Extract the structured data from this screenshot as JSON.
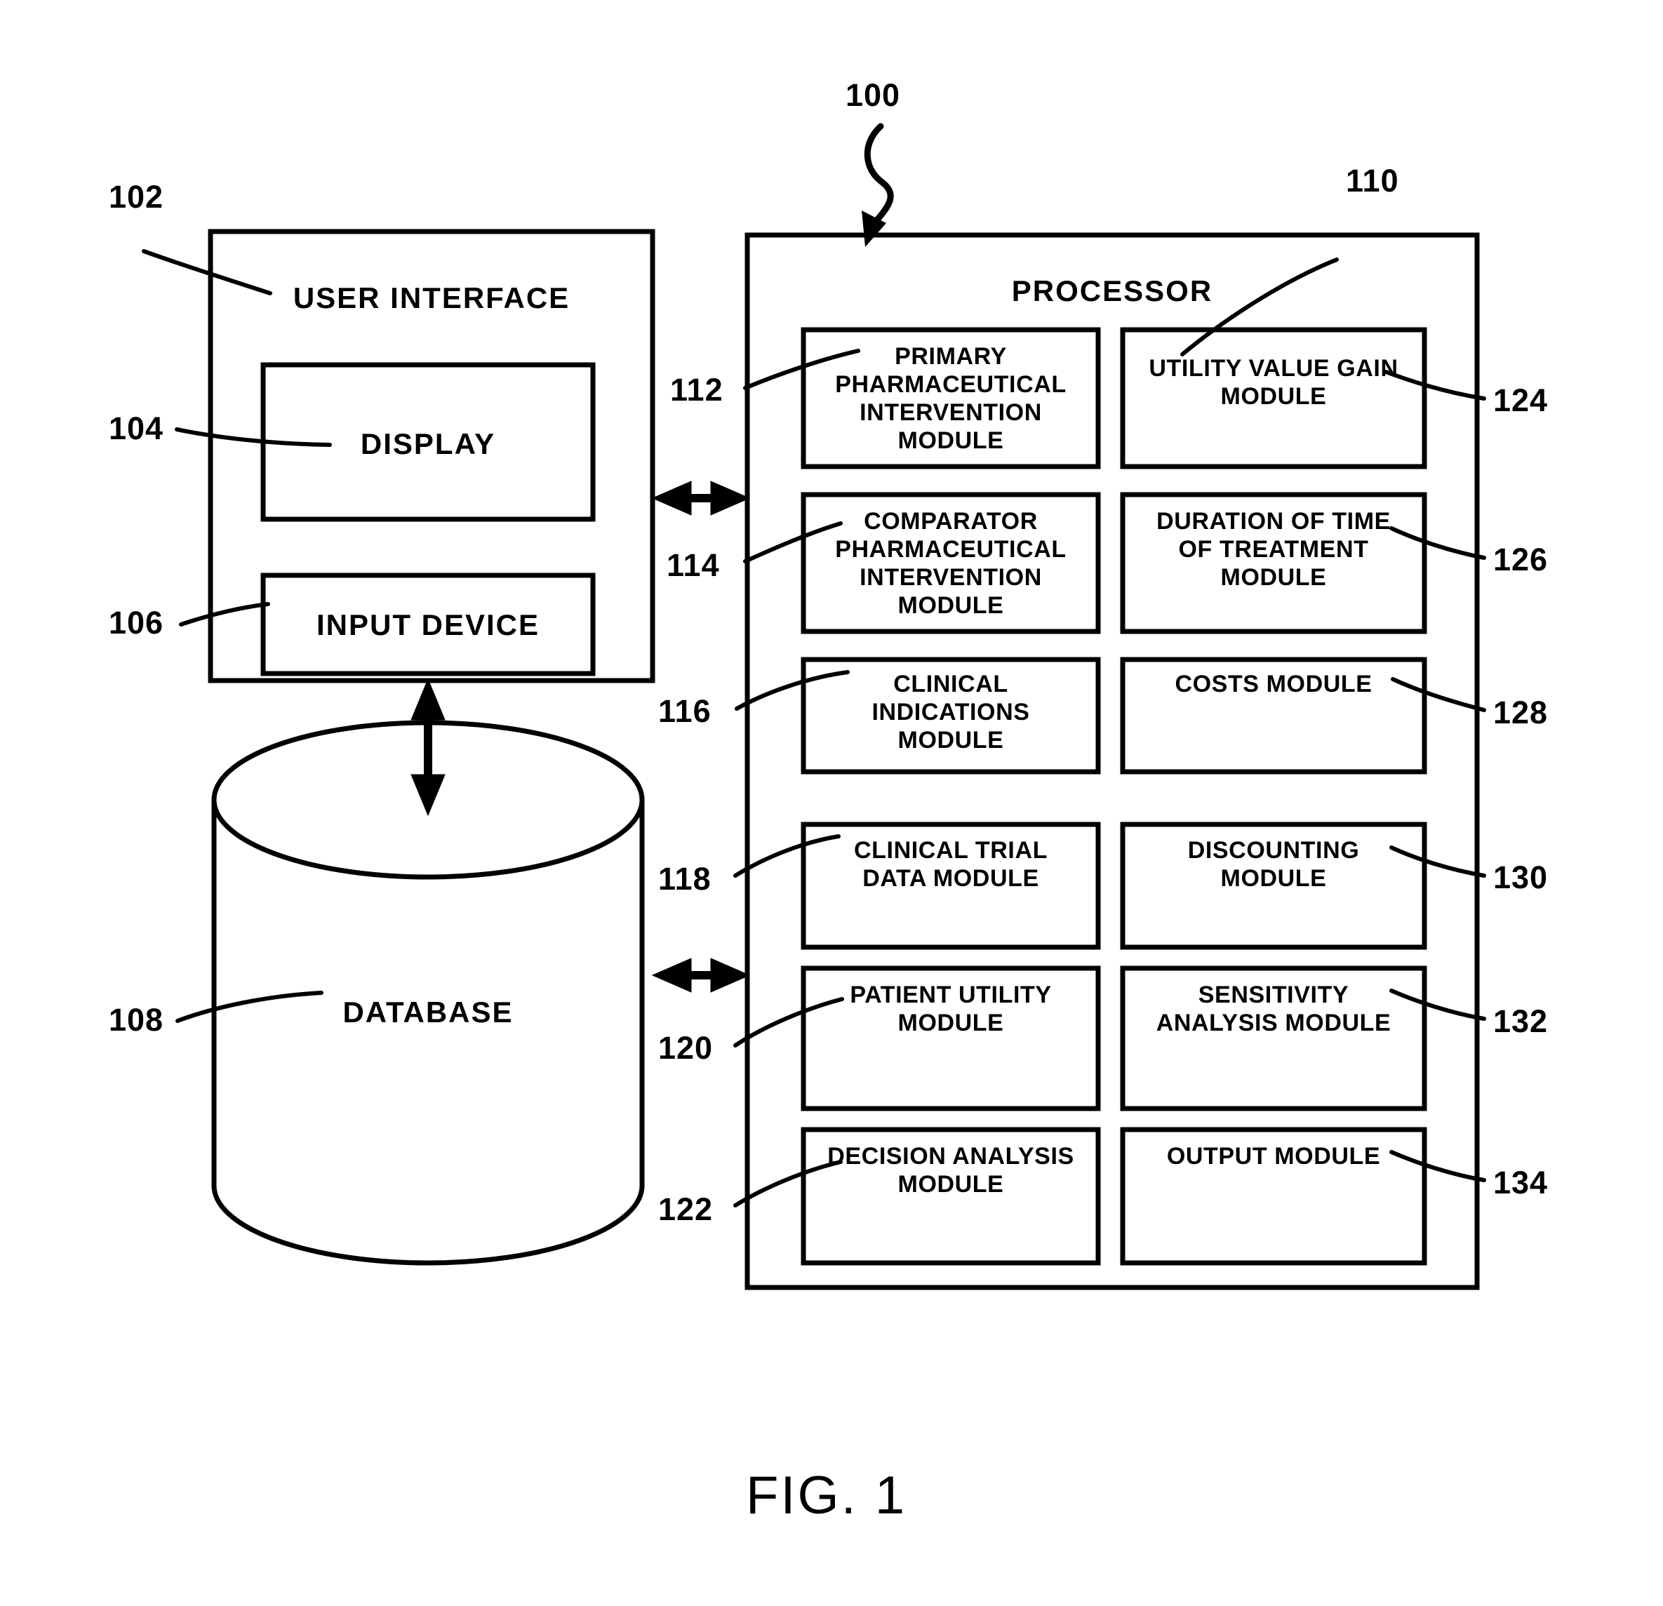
{
  "figure": {
    "caption": "FIG. 1",
    "system_ref": "100"
  },
  "user_interface": {
    "ref": "102",
    "title": "USER INTERFACE",
    "children": [
      {
        "ref": "104",
        "label": "DISPLAY"
      },
      {
        "ref": "106",
        "label": "INPUT DEVICE"
      }
    ]
  },
  "database": {
    "ref": "108",
    "label": "DATABASE"
  },
  "processor": {
    "ref": "110",
    "title": "PROCESSOR",
    "left_column": [
      {
        "ref": "112",
        "label": "PRIMARY\nPHARMACEUTICAL\nINTERVENTION\nMODULE"
      },
      {
        "ref": "114",
        "label": "COMPARATOR\nPHARMACEUTICAL\nINTERVENTION\nMODULE"
      },
      {
        "ref": "116",
        "label": "CLINICAL\nINDICATIONS\nMODULE"
      },
      {
        "ref": "118",
        "label": "CLINICAL TRIAL\nDATA MODULE"
      },
      {
        "ref": "120",
        "label": "PATIENT UTILITY\nMODULE"
      },
      {
        "ref": "122",
        "label": "DECISION ANALYSIS\nMODULE"
      }
    ],
    "right_column": [
      {
        "ref": "124",
        "label": "UTILITY VALUE GAIN\nMODULE"
      },
      {
        "ref": "126",
        "label": "DURATION OF TIME\nOF TREATMENT\nMODULE"
      },
      {
        "ref": "128",
        "label": "COSTS MODULE"
      },
      {
        "ref": "130",
        "label": "DISCOUNTING\nMODULE"
      },
      {
        "ref": "132",
        "label": "SENSITIVITY\nANALYSIS MODULE"
      },
      {
        "ref": "134",
        "label": "OUTPUT MODULE"
      }
    ]
  },
  "connectors": [
    {
      "name": "ui-to-processor",
      "kind": "double-arrow-horizontal"
    },
    {
      "name": "ui-to-database",
      "kind": "double-arrow-vertical"
    },
    {
      "name": "database-to-processor",
      "kind": "double-arrow-horizontal"
    }
  ],
  "style": {
    "line_color": "#000000",
    "background": "#ffffff"
  }
}
